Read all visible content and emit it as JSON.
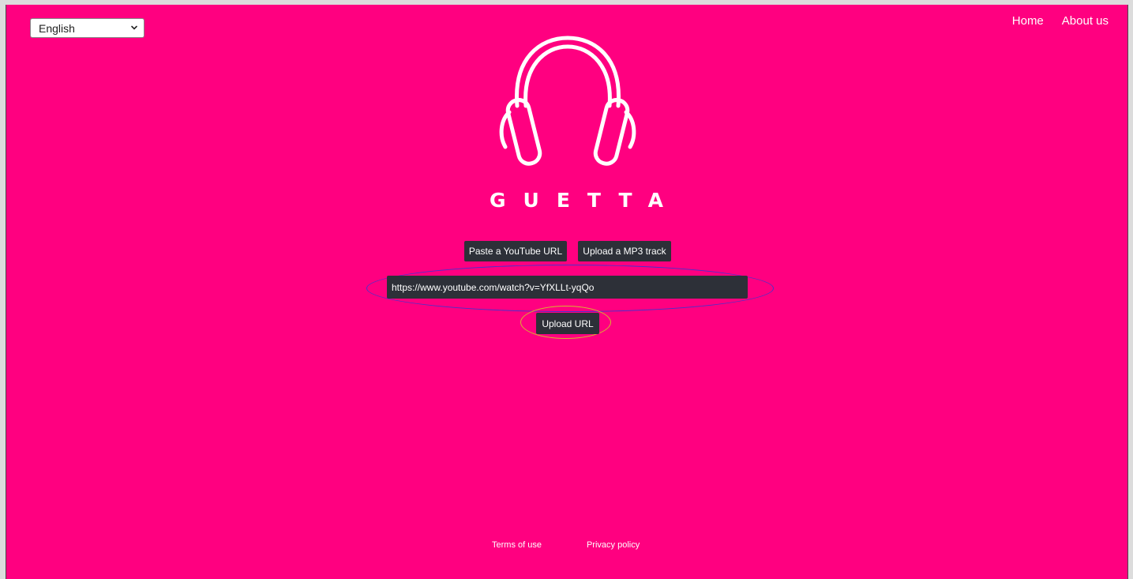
{
  "language_select": {
    "value": "English"
  },
  "nav": {
    "home": "Home",
    "about": "About us"
  },
  "brand": {
    "name": "GUETTA",
    "logo_icon": "headphones-icon"
  },
  "source_tabs": {
    "youtube": "Paste a YouTube URL",
    "mp3": "Upload a MP3 track"
  },
  "url_input": {
    "value": "https://www.youtube.com/watch?v=YfXLLt-yqQo"
  },
  "upload_button": {
    "label": "Upload URL"
  },
  "footer": {
    "terms": "Terms of use",
    "privacy": "Privacy policy"
  },
  "colors": {
    "background": "#ff0080",
    "button": "#2d3038",
    "highlight_blue": "#4b30c8",
    "highlight_yellow": "#d6b82e"
  }
}
